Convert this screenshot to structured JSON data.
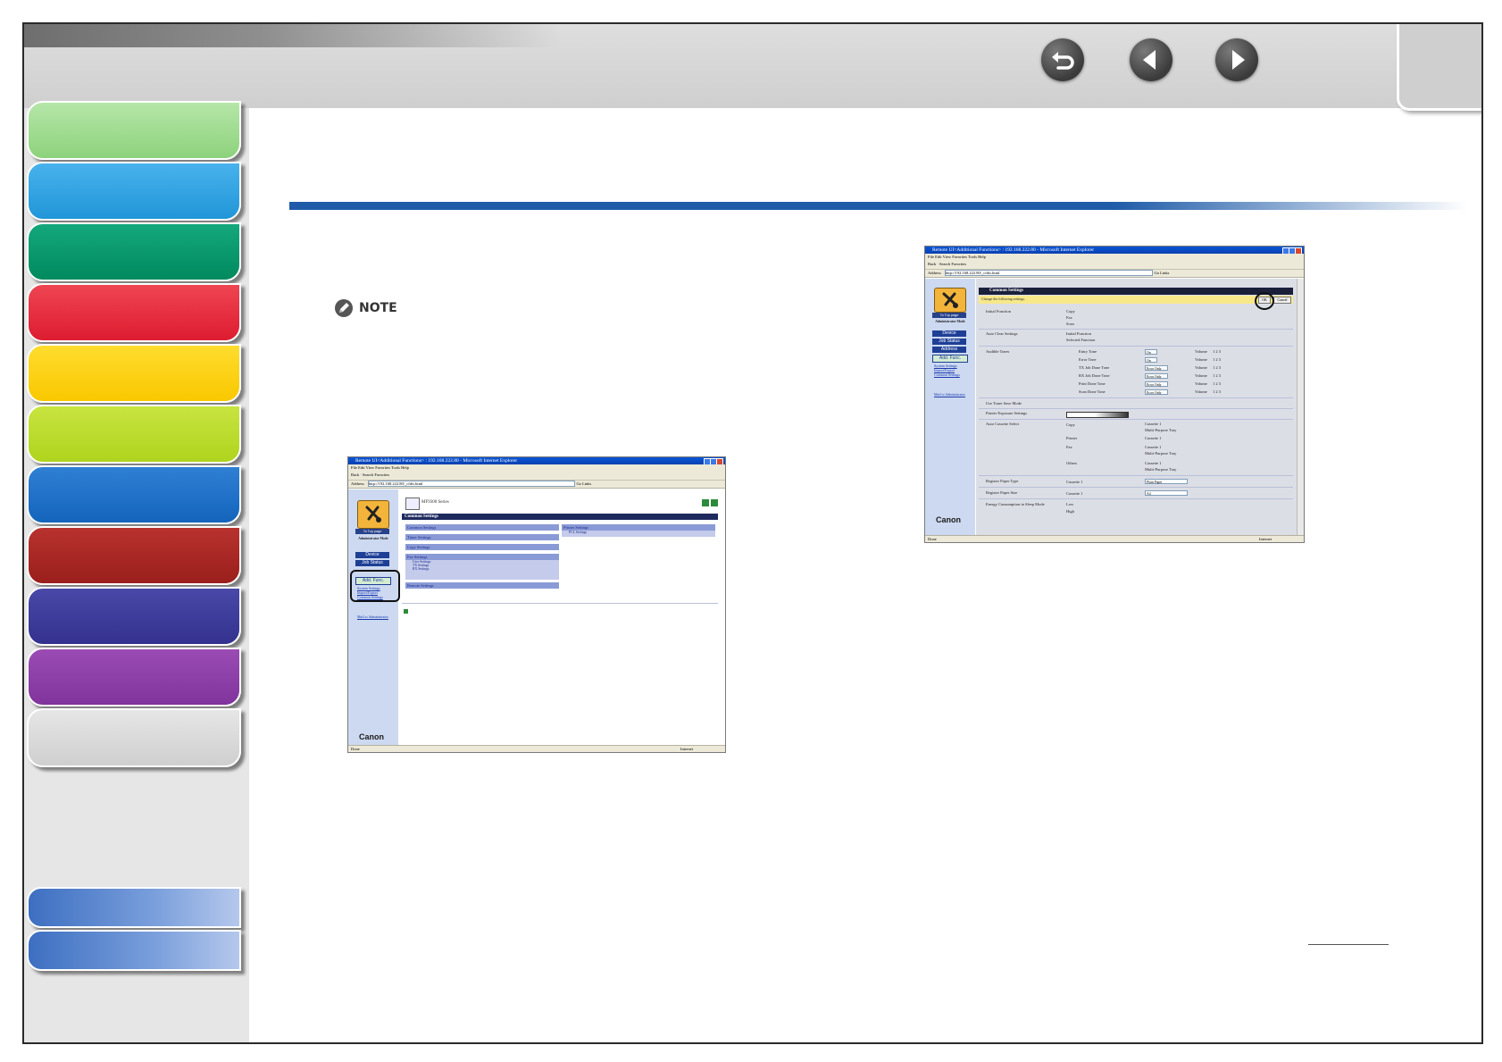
{
  "header": {
    "nav_buttons": [
      {
        "name": "back-icon",
        "symbol": "undo"
      },
      {
        "name": "previous-page-icon",
        "symbol": "arrow-left"
      },
      {
        "name": "next-page-icon",
        "symbol": "arrow-right"
      }
    ]
  },
  "sidebar": {
    "chapters": [
      {
        "color": "#9bd98c"
      },
      {
        "color": "#2e9fe0"
      },
      {
        "color": "#00956a"
      },
      {
        "color": "#e4283a"
      },
      {
        "color": "#fdd10a"
      },
      {
        "color": "#b9dc28"
      },
      {
        "color": "#1e6ec4"
      },
      {
        "color": "#a62622"
      },
      {
        "color": "#3c3a98"
      },
      {
        "color": "#8b3ea3"
      },
      {
        "color": "#d8d8d8"
      }
    ]
  },
  "note": {
    "label": "NOTE",
    "icon": "pencil-icon"
  },
  "screenshot_left": {
    "window_title": "Remote UI<Additional Functions> : 192.168.222.80 - Microsoft Internet Explorer",
    "menu": "File   Edit   View   Favorites   Tools   Help",
    "toolbar": "Back  ·  Search  Favorites",
    "address_label": "Address",
    "address_url": "http://192.168.222.80/_cfdw.html",
    "go_label": "Go",
    "links_label": "Links",
    "device_name": "MF9300 Series",
    "sidebar": {
      "top_page": "To Top page",
      "mode": "Administrator Mode",
      "buttons": [
        "Device",
        "Job Status"
      ],
      "active_button": "Add. Func.",
      "links": [
        "System Settings",
        "Import/Export",
        "Common Settings"
      ],
      "mail": "Mail to Administrator",
      "brand": "Canon"
    },
    "settings_header": "Common Settings",
    "left_column": [
      "Common Settings",
      "Timer Settings",
      "Copy Settings",
      "Fax Settings",
      "Remote Settings"
    ],
    "fax_sub": [
      "User Settings",
      "TX Settings",
      "RX Settings"
    ],
    "right_column": [
      "Printer Settings"
    ],
    "printer_sub": [
      "PCL Settings"
    ],
    "status_left": "Done",
    "status_right": "Internet"
  },
  "screenshot_right": {
    "window_title": "Remote UI<Additional Functions> : 192.168.222.80 - Microsoft Internet Explorer",
    "menu": "File   Edit   View   Favorites   Tools   Help",
    "toolbar": "Back  ·  Search  Favorites",
    "address_label": "Address",
    "address_url": "http://192.168.222.80/_cfdw.html",
    "go_label": "Go",
    "links_label": "Links",
    "sidebar": {
      "top_page": "To Top page",
      "mode": "Administrator Mode",
      "buttons": [
        "Device",
        "Job Status",
        "Address"
      ],
      "active_button": "Add. Func.",
      "links": [
        "System Settings",
        "Import/Export",
        "Common Settings"
      ],
      "mail": "Mail to Administrator",
      "brand": "Canon"
    },
    "header": "Common Settings",
    "instruction": "Change the following settings.",
    "ok_label": "OK",
    "cancel_label": "Cancel",
    "rows": [
      {
        "label": "Initial Function",
        "options": [
          "Copy",
          "Fax",
          "Scan"
        ]
      },
      {
        "label": "Auto Clear Settings",
        "options": [
          "Initial Function",
          "Selected Function"
        ]
      },
      {
        "label": "Audible Tones"
      },
      {
        "label": "Use Toner Save Mode"
      },
      {
        "label": "Printer Exposure Settings"
      },
      {
        "label": "Auto Cassette Select"
      },
      {
        "label": "Register Paper Type"
      },
      {
        "label": "Register Paper Size"
      },
      {
        "label": "Energy Consumption in Sleep Mode",
        "options": [
          "Low",
          "High"
        ]
      }
    ],
    "tones": [
      {
        "name": "Entry Tone",
        "value": "On"
      },
      {
        "name": "Error Tone",
        "value": "On"
      },
      {
        "name": "TX Job Done Tone",
        "value": "Error Only"
      },
      {
        "name": "RX Job Done Tone",
        "value": "Error Only"
      },
      {
        "name": "Print Done Tone",
        "value": "Error Only"
      },
      {
        "name": "Scan Done Tone",
        "value": "Error Only"
      }
    ],
    "volume_label": "Volume",
    "volume_options": "1  2  3",
    "cassette_groups": [
      {
        "name": "Copy",
        "items": [
          "Cassette 1",
          "Multi-Purpose Tray"
        ]
      },
      {
        "name": "Printer",
        "items": [
          "Cassette 1"
        ]
      },
      {
        "name": "Fax",
        "items": [
          "Cassette 1",
          "Multi-Purpose Tray"
        ]
      },
      {
        "name": "Others",
        "items": [
          "Cassette 1",
          "Multi-Purpose Tray"
        ]
      }
    ],
    "paper_type": {
      "source": "Cassette 1",
      "value": "Plain Paper"
    },
    "paper_size": {
      "source": "Cassette 1",
      "value": "A4"
    },
    "status_left": "Done",
    "status_right": "Internet"
  }
}
